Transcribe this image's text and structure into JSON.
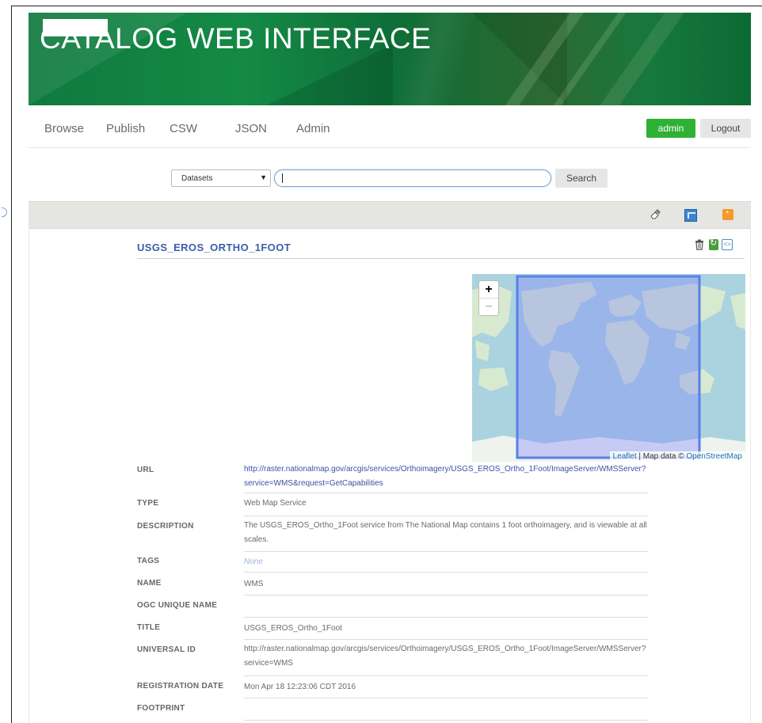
{
  "banner": {
    "title": "CATALOG WEB INTERFACE"
  },
  "nav": {
    "items": [
      {
        "label": "Browse"
      },
      {
        "label": "Publish"
      },
      {
        "label": "CSW"
      },
      {
        "label": "JSON"
      },
      {
        "label": "Admin"
      }
    ],
    "user_label": "admin",
    "logout_label": "Logout"
  },
  "search": {
    "type_value": "Datasets",
    "query_value": "",
    "button_label": "Search"
  },
  "toolbar": {
    "icons": [
      "eraser-icon",
      "kml-icon",
      "rss-icon"
    ]
  },
  "record": {
    "title": "USGS_EROS_ORTHO_1FOOT",
    "map": {
      "zoom_in": "+",
      "zoom_out": "−",
      "attribution_leaflet": "Leaflet",
      "attribution_sep": " | Map data © ",
      "attribution_osm": "OpenStreetMap"
    },
    "fields": [
      {
        "label": "URL",
        "value": "http://raster.nationalmap.gov/arcgis/services/Orthoimagery/USGS_EROS_Ortho_1Foot/ImageServer/WMSServer?service=WMS&request=GetCapabilities"
      },
      {
        "label": "TYPE",
        "value": "Web Map Service"
      },
      {
        "label": "DESCRIPTION",
        "value": "The USGS_EROS_Ortho_1Foot service from The National Map contains 1 foot orthoimagery, and is viewable at all scales."
      },
      {
        "label": "TAGS",
        "value": "None"
      },
      {
        "label": "NAME",
        "value": "WMS"
      },
      {
        "label": "OGC UNIQUE NAME",
        "value": ""
      },
      {
        "label": "TITLE",
        "value": "USGS_EROS_Ortho_1Foot"
      },
      {
        "label": "UNIVERSAL ID",
        "value": "http://raster.nationalmap.gov/arcgis/services/Orthoimagery/USGS_EROS_Ortho_1Foot/ImageServer/WMSServer?service=WMS"
      },
      {
        "label": "REGISTRATION DATE",
        "value": "Mon Apr 18 12:23:06 CDT 2016"
      },
      {
        "label": "FOOTPRINT",
        "value": ""
      }
    ]
  },
  "colors": {
    "banner_green": "#148a45",
    "admin_green": "#2eb135",
    "title_blue": "#3b5dab",
    "link_blue": "#3a53a4",
    "bbox_blue": "#5a7fe8"
  }
}
